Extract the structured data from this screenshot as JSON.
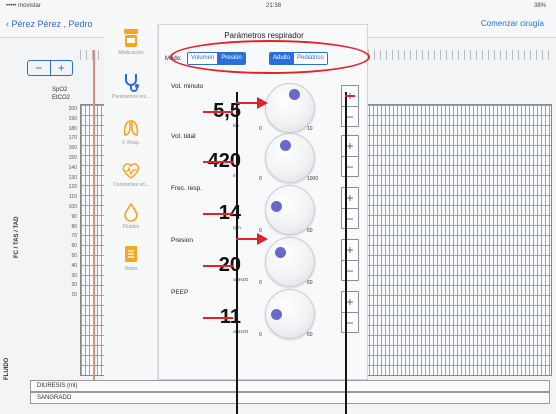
{
  "statusbar": {
    "carrier": "••••• movistar",
    "time": "21:38",
    "battery": "38%"
  },
  "navbar": {
    "back_label": "Pérez Pérez , Pedro",
    "action_label": "Comenzar cirugía"
  },
  "chart": {
    "stepper": [
      "−",
      "+"
    ],
    "vitals": [
      "SpO2",
      "EtCO2"
    ],
    "y_ticks": [
      "200",
      "190",
      "180",
      "170",
      "160",
      "150",
      "140",
      "130",
      "120",
      "110",
      "100",
      "90",
      "80",
      "70",
      "60",
      "50",
      "40",
      "30",
      "20",
      "10"
    ],
    "y_label": "FC / TAS / TAD"
  },
  "bottom": {
    "fluido_label": "FLUIDO",
    "rows": [
      "DIURESIS (ml)",
      "SANGRADO"
    ]
  },
  "sidemenu": {
    "items": [
      {
        "label": "Medicación",
        "icon": "medication-icon"
      },
      {
        "label": "Parámetros res...",
        "icon": "stethoscope-icon"
      },
      {
        "label": "V. Resp.",
        "icon": "lungs-icon"
      },
      {
        "label": "Constantes vit...",
        "icon": "heart-rate-icon"
      },
      {
        "label": "Fluidos",
        "icon": "drop-icon"
      },
      {
        "label": "Notas",
        "icon": "notes-icon"
      }
    ]
  },
  "modal": {
    "title": "Parámetros respirador",
    "mode_label": "Modo:",
    "mode_group_1": [
      {
        "label": "Volumen",
        "active": false
      },
      {
        "label": "Presión",
        "active": true
      }
    ],
    "mode_group_2": [
      {
        "label": "Adulto",
        "active": true
      },
      {
        "label": "Pediátrico",
        "active": false
      }
    ],
    "params": [
      {
        "label": "Vol. minuto",
        "value": "5,5",
        "unit": "l/m",
        "min": "0",
        "max": "10",
        "level": 0.55
      },
      {
        "label": "Vol. tidal",
        "value": "420",
        "unit": "ml",
        "min": "0",
        "max": "1000",
        "level": 0.42
      },
      {
        "label": "Frec. resp.",
        "value": "14",
        "unit": "rpm",
        "min": "0",
        "max": "60",
        "level": 0.23
      },
      {
        "label": "Presion",
        "value": "20",
        "unit": "cmH2O",
        "min": "0",
        "max": "60",
        "level": 0.33
      },
      {
        "label": "PEEP",
        "value": "11",
        "unit": "cmH2O",
        "min": "0",
        "max": "60",
        "level": 0.18
      }
    ],
    "plus": "+",
    "minus": "−"
  },
  "colors": {
    "accent": "#2a6fd8",
    "knob_dot": "#6a68c8",
    "annotation": "#e4202a"
  }
}
